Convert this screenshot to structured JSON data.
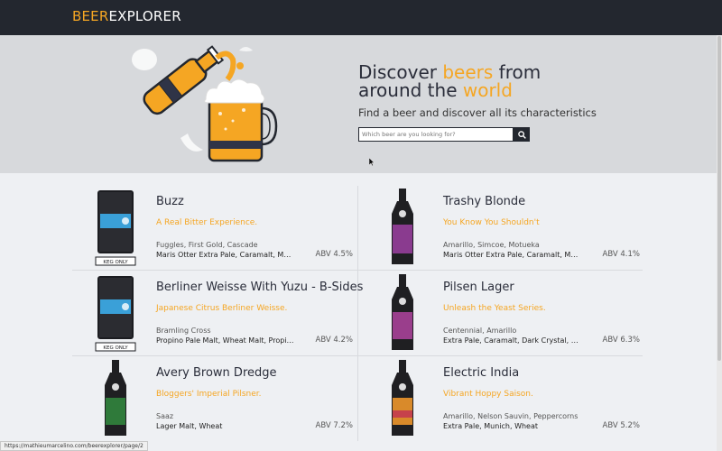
{
  "header": {
    "logo_part1": "BEER",
    "logo_part2": "EXPLORER",
    "accent": "#f5a623",
    "bg": "#23272f"
  },
  "hero": {
    "title_line1_a": "Discover ",
    "title_line1_b": "beers",
    "title_line1_c": " from",
    "title_line2_a": "around the ",
    "title_line2_b": "world",
    "subtitle": "Find a beer and discover all its characteristics",
    "search_placeholder": "Which beer are you looking for?",
    "search_icon": "search-icon"
  },
  "beers": [
    {
      "name": "Buzz",
      "tagline": "A Real Bitter Experience.",
      "hops": "Fuggles, First Gold, Cascade",
      "malts": "Maris Otter Extra Pale, Caramalt, Munich",
      "abv": "ABV 4.5%",
      "image": "keg",
      "keg_label": "KEG ONLY"
    },
    {
      "name": "Trashy Blonde",
      "tagline": "You Know You Shouldn't",
      "hops": "Amarillo, Simcoe, Motueka",
      "malts": "Maris Otter Extra Pale, Caramalt, Munich",
      "abv": "ABV 4.1%",
      "image": "bottle",
      "label_color": "#8a3b8f"
    },
    {
      "name": "Berliner Weisse With Yuzu - B-Sides",
      "tagline": "Japanese Citrus Berliner Weisse.",
      "hops": "Bramling Cross",
      "malts": "Propino Pale Malt, Wheat Malt, Propino",
      "abv": "ABV 4.2%",
      "image": "keg",
      "keg_label": "KEG ONLY"
    },
    {
      "name": "Pilsen Lager",
      "tagline": "Unleash the Yeast Series.",
      "hops": "Centennial, Amarillo",
      "malts": "Extra Pale, Caramalt, Dark Crystal, Munich",
      "abv": "ABV 6.3%",
      "image": "bottle",
      "label_color": "#9a3e8c"
    },
    {
      "name": "Avery Brown Dredge",
      "tagline": "Bloggers' Imperial Pilsner.",
      "hops": "Saaz",
      "malts": "Lager Malt, Wheat",
      "abv": "ABV 7.2%",
      "image": "bottle",
      "label_color": "#2f7a3a"
    },
    {
      "name": "Electric India",
      "tagline": "Vibrant Hoppy Saison.",
      "hops": "Amarillo, Nelson Sauvin, Peppercorns",
      "malts": "Extra Pale, Munich, Wheat",
      "abv": "ABV 5.2%",
      "image": "bottle",
      "label_color": "#d98a2a"
    }
  ],
  "status_bar": {
    "url": "https://mathieumarcelino.com/beerexplorer/page/2"
  }
}
